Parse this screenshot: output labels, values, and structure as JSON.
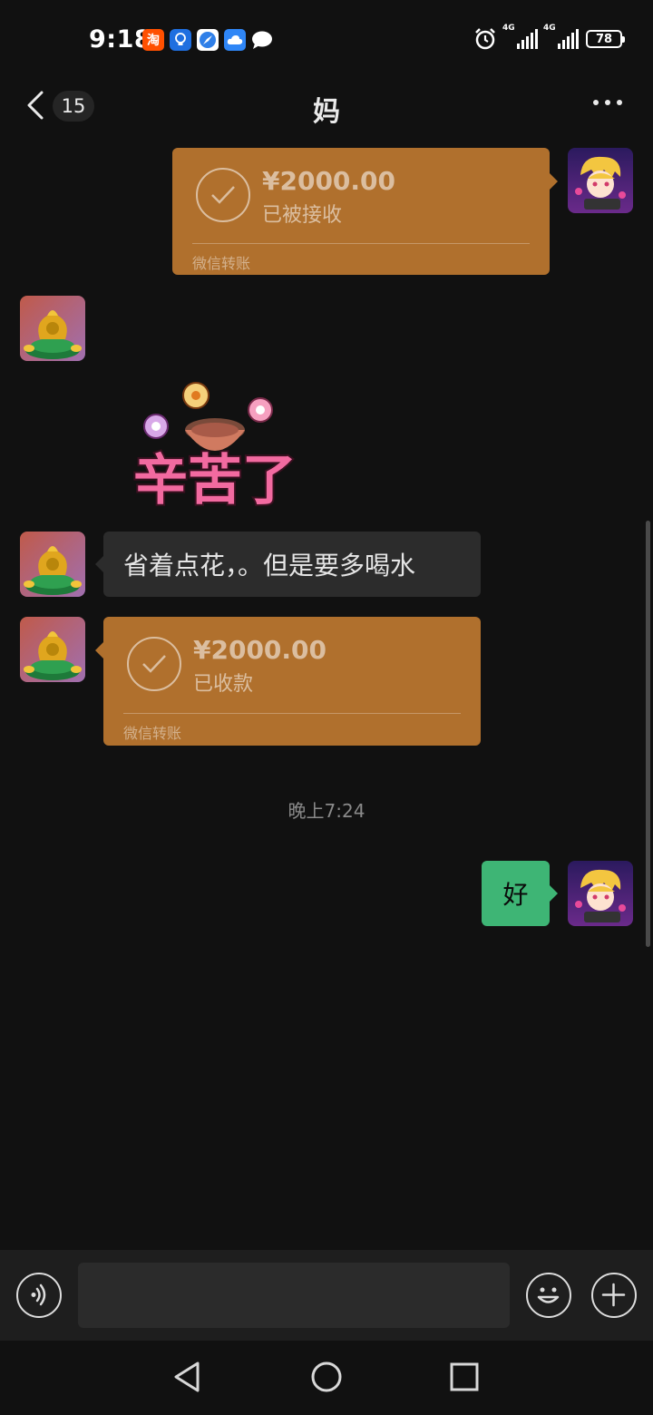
{
  "status_bar": {
    "time": "9:18",
    "app_icons": [
      "taobao-icon",
      "bulb-icon",
      "safari-icon",
      "cloud-icon",
      "message-bubble-icon"
    ],
    "taobao_label": "淘",
    "network_1": "4G",
    "network_2": "4G",
    "battery": "78"
  },
  "header": {
    "unread_count": "15",
    "title": "妈"
  },
  "messages": [
    {
      "type": "transfer",
      "direction": "outgoing",
      "amount": "¥2000.00",
      "status": "已被接收",
      "footer": "微信转账"
    },
    {
      "type": "sticker",
      "direction": "incoming",
      "sticker_text": "辛苦了"
    },
    {
      "type": "text",
      "direction": "incoming",
      "text": "省着点花，。但是要多喝水"
    },
    {
      "type": "transfer",
      "direction": "incoming",
      "amount": "¥2000.00",
      "status": "已收款",
      "footer": "微信转账"
    },
    {
      "type": "timestamp",
      "text": "晚上7:24"
    },
    {
      "type": "text",
      "direction": "outgoing",
      "text": "好"
    }
  ],
  "input": {
    "value": "",
    "placeholder": ""
  },
  "colors": {
    "background": "#111111",
    "transfer_bubble": "#b0702d",
    "outgoing_bubble": "#3eb575",
    "incoming_bubble": "#2c2c2c"
  }
}
